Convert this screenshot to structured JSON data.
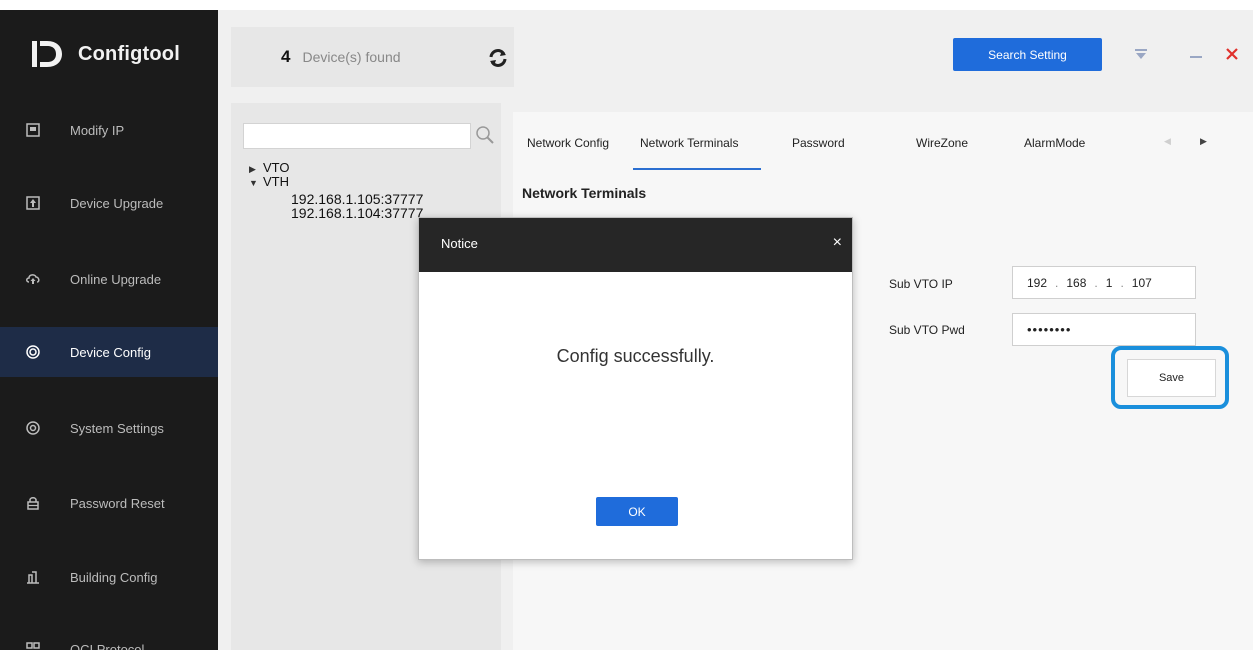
{
  "app": {
    "title": "Configtool"
  },
  "header": {
    "device_count": "4",
    "device_label": "Device(s) found",
    "search_setting_label": "Search Setting"
  },
  "sidebar": {
    "items": [
      {
        "label": "Modify IP",
        "icon": "ip-icon"
      },
      {
        "label": "Device Upgrade",
        "icon": "upgrade-icon"
      },
      {
        "label": "Online Upgrade",
        "icon": "cloud-upgrade-icon"
      },
      {
        "label": "Device Config",
        "icon": "target-icon",
        "active": true
      },
      {
        "label": "System Settings",
        "icon": "gear-icon"
      },
      {
        "label": "Password Reset",
        "icon": "lock-icon"
      },
      {
        "label": "Building Config",
        "icon": "building-icon"
      },
      {
        "label": "OCI Protocol",
        "icon": "protocol-icon"
      }
    ]
  },
  "tree": {
    "search_placeholder": "",
    "nodes": {
      "vto": "VTO",
      "vth": "VTH",
      "vth_child_1": "192.168.1.105:37777",
      "vth_child_2": "192.168.1.104:37777"
    }
  },
  "tabs": {
    "items": [
      "Network Config",
      "Network Terminals",
      "Password",
      "WireZone",
      "AlarmMode"
    ],
    "active": "Network Terminals"
  },
  "section": {
    "title": "Network Terminals",
    "sub_vto_ip_label": "Sub VTO IP",
    "sub_vto_ip": [
      "192",
      "168",
      "1",
      "107"
    ],
    "sub_vto_pwd_label": "Sub VTO Pwd",
    "sub_vto_pwd": "••••••••",
    "save_label": "Save"
  },
  "modal": {
    "title": "Notice",
    "close_glyph": "×",
    "message": "Config successfully.",
    "ok_label": "OK"
  },
  "colors": {
    "accent": "#1f6cdb",
    "highlight": "#1a8fdc",
    "sidebar_bg": "#1b1b1b",
    "sidebar_active": "#1e2c47",
    "close_red": "#e0302b"
  }
}
